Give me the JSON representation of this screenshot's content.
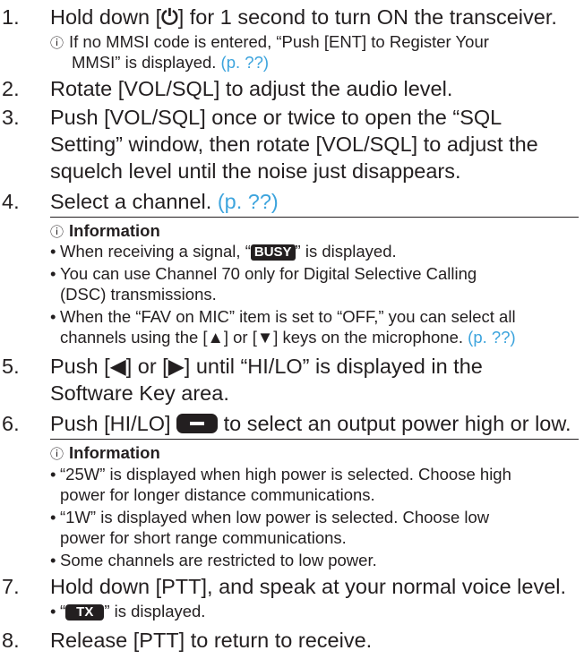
{
  "steps": [
    {
      "num": "1.",
      "pre": "Hold down [",
      "key": "⏻",
      "post": "] for 1 second to turn ON the transceiver."
    },
    {
      "num": "2.",
      "text": "Rotate [VOL/SQL] to adjust the audio level."
    },
    {
      "num": "3.",
      "lines": [
        "Push [VOL/SQL] once or twice to open the “SQL",
        "Setting” window, then rotate [VOL/SQL] to adjust the",
        "squelch level until the noise just disappears."
      ]
    },
    {
      "num": "4.",
      "text": "Select a channel.",
      "link": "(p. ??)"
    },
    {
      "num": "5.",
      "lines": [
        "Push [◀] or [▶] until “HI/LO” is displayed in the",
        "Software Key area."
      ]
    },
    {
      "num": "6.",
      "pre": "Push [HI/LO]",
      "post": "to select an output power high or low."
    },
    {
      "num": "7.",
      "text": "Hold down [PTT], and speak at your normal voice level."
    },
    {
      "num": "8.",
      "text": "Release [PTT] to return to receive."
    }
  ],
  "note1": {
    "icon": "ⓘ",
    "line1": "If no MMSI code is entered, “Push [ENT] to Register Your",
    "line2": "MMSI” is displayed.",
    "link": "(p. ??)"
  },
  "info1": {
    "icon": "ⓘ",
    "title": "Information",
    "b1_pre": "When receiving a signal, “",
    "b1_badge": "BUSY",
    "b1_post": "” is displayed.",
    "b2_l1": "You can use Channel 70 only for Digital Selective Calling",
    "b2_l2": "(DSC) transmissions.",
    "b3_l1": "When the “FAV on MIC” item is set to “OFF,” you can select all",
    "b3_l2": "channels using the [▲] or [▼] keys on the microphone.",
    "b3_link": "(p. ??)"
  },
  "info2": {
    "icon": "ⓘ",
    "title": "Information",
    "b1_l1": "“25W” is displayed when high power is selected. Choose high",
    "b1_l2": "power for longer distance communications.",
    "b2_l1": "“1W” is displayed when low power is selected. Choose low",
    "b2_l2": "power for short range communications.",
    "b3": "Some channels are restricted to low power."
  },
  "step7_bullet": {
    "pre": "“",
    "badge": "TX",
    "post": "” is displayed."
  },
  "bullet_char": "•"
}
